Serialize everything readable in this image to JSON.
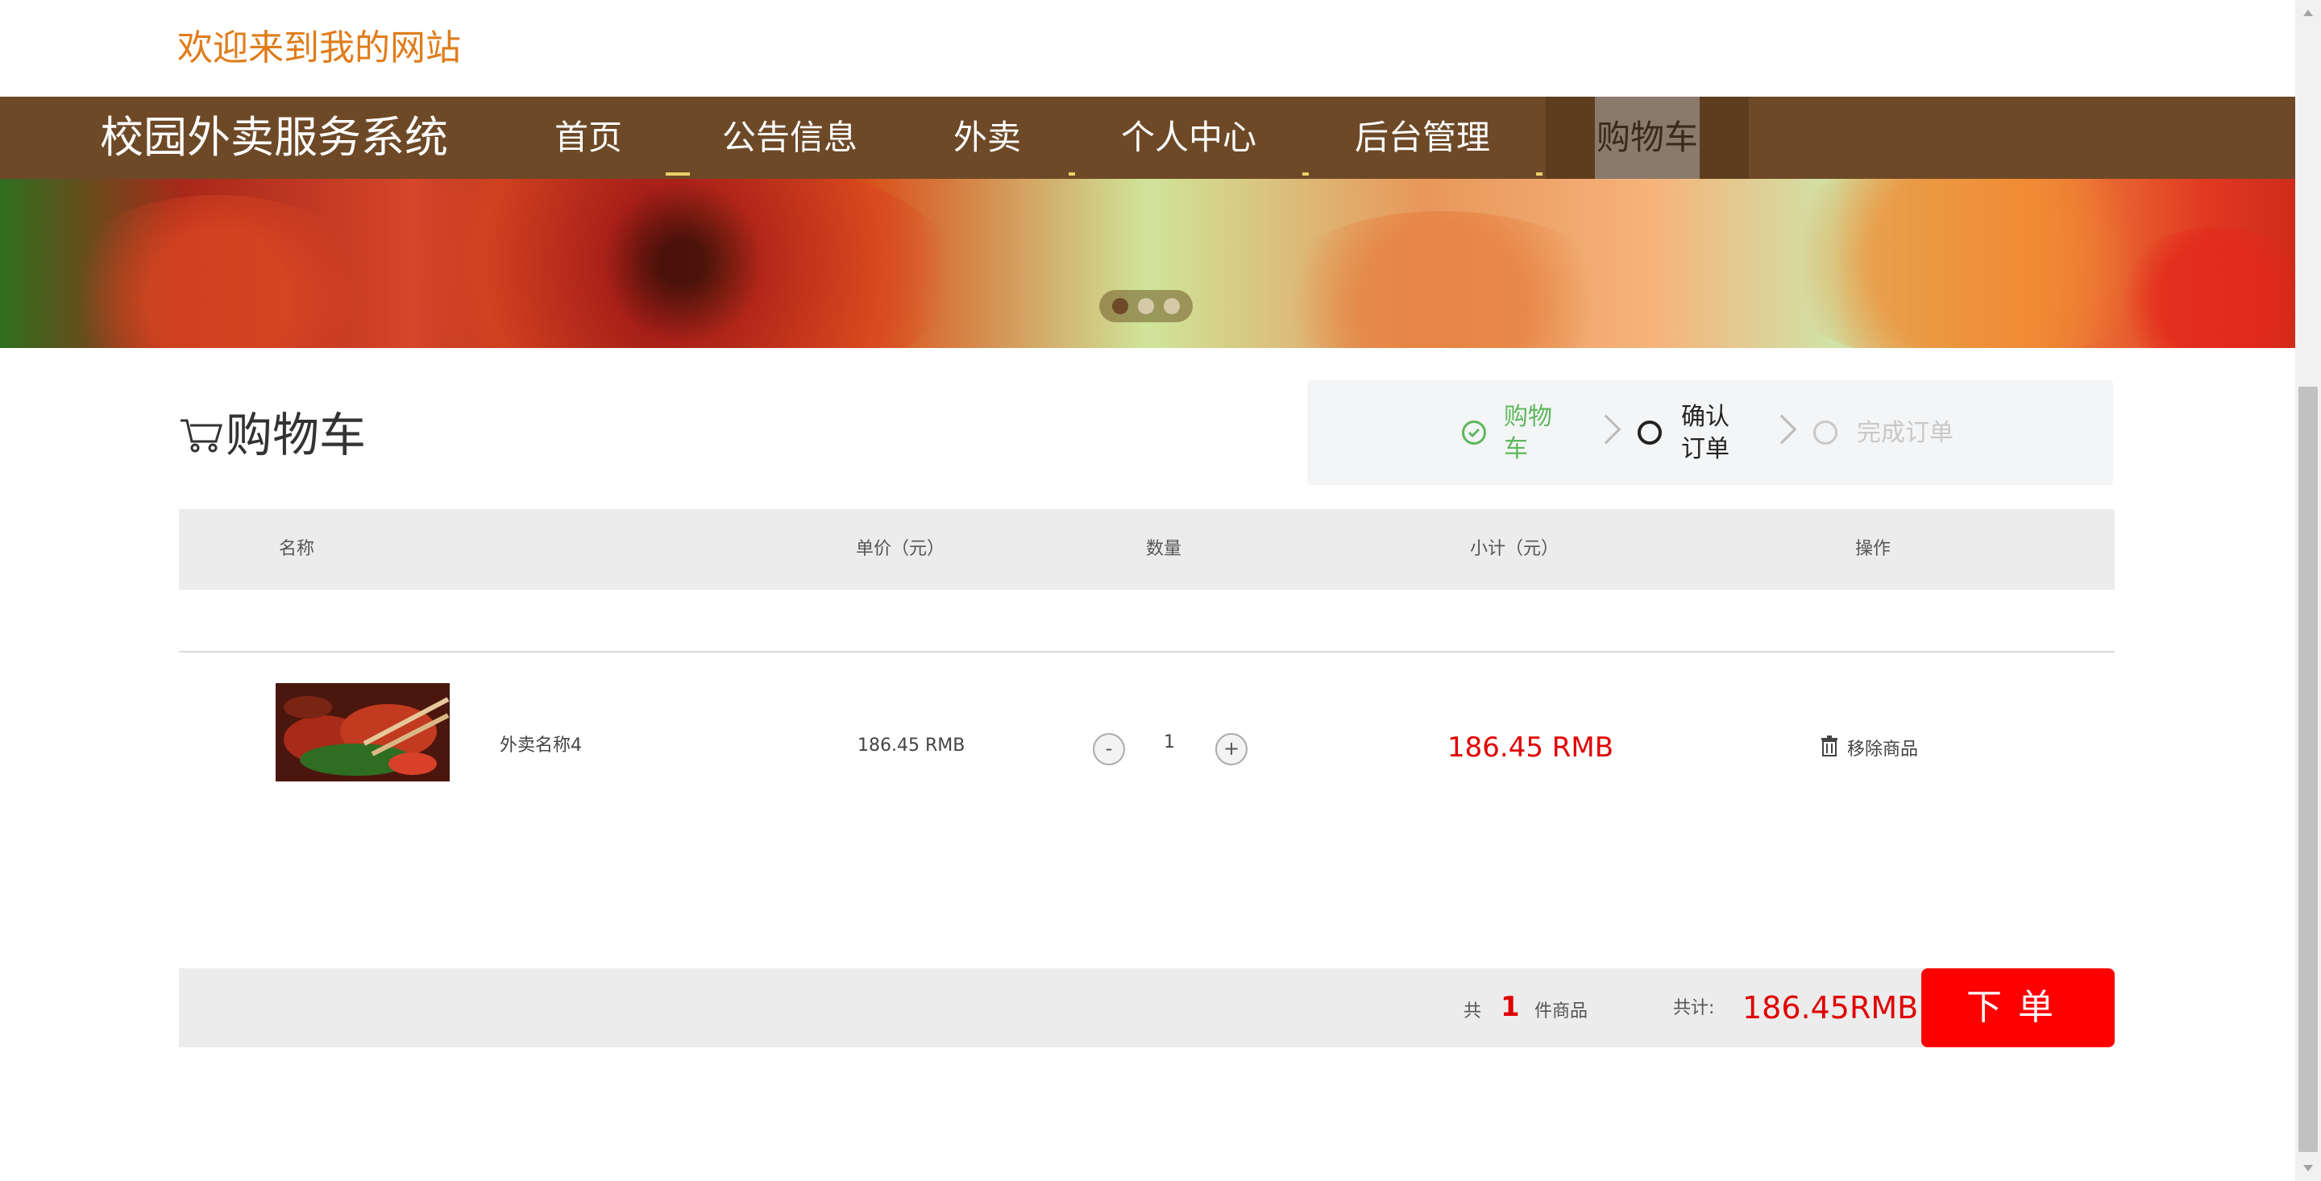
{
  "header": {
    "welcome": "欢迎来到我的网站"
  },
  "nav": {
    "brand": "校园外卖服务系统",
    "items": [
      {
        "label": "首页"
      },
      {
        "label": "公告信息"
      },
      {
        "label": "外卖"
      },
      {
        "label": "个人中心"
      },
      {
        "label": "后台管理"
      },
      {
        "label": "购物车"
      }
    ],
    "active_index": 5
  },
  "banner": {
    "slide_count": 3,
    "active_slide": 1
  },
  "cart": {
    "title": "购物车"
  },
  "steps": [
    {
      "label_line1": "购物",
      "label_line2": "车",
      "state": "done"
    },
    {
      "label_line1": "确认",
      "label_line2": "订单",
      "state": "current"
    },
    {
      "label": "完成订单",
      "state": "pending"
    }
  ],
  "table": {
    "headers": [
      "名称",
      "单价（元）",
      "数量",
      "小计（元）",
      "操作"
    ],
    "rows": [
      {
        "name": "外卖名称4",
        "price": "186.45 RMB",
        "qty": "1",
        "subtotal": "186.45 RMB",
        "action": "移除商品"
      }
    ]
  },
  "footer": {
    "prefix": "共",
    "count": "1",
    "suffix": "件商品",
    "total_label": "共计:",
    "total_value": "186.45RMB",
    "order_button": "下单"
  },
  "colors": {
    "accent": "#6d4927",
    "welcome": "#e07c1a",
    "price_red": "#e00000",
    "button_red": "#ff0000",
    "step_done": "#5cb85c"
  }
}
